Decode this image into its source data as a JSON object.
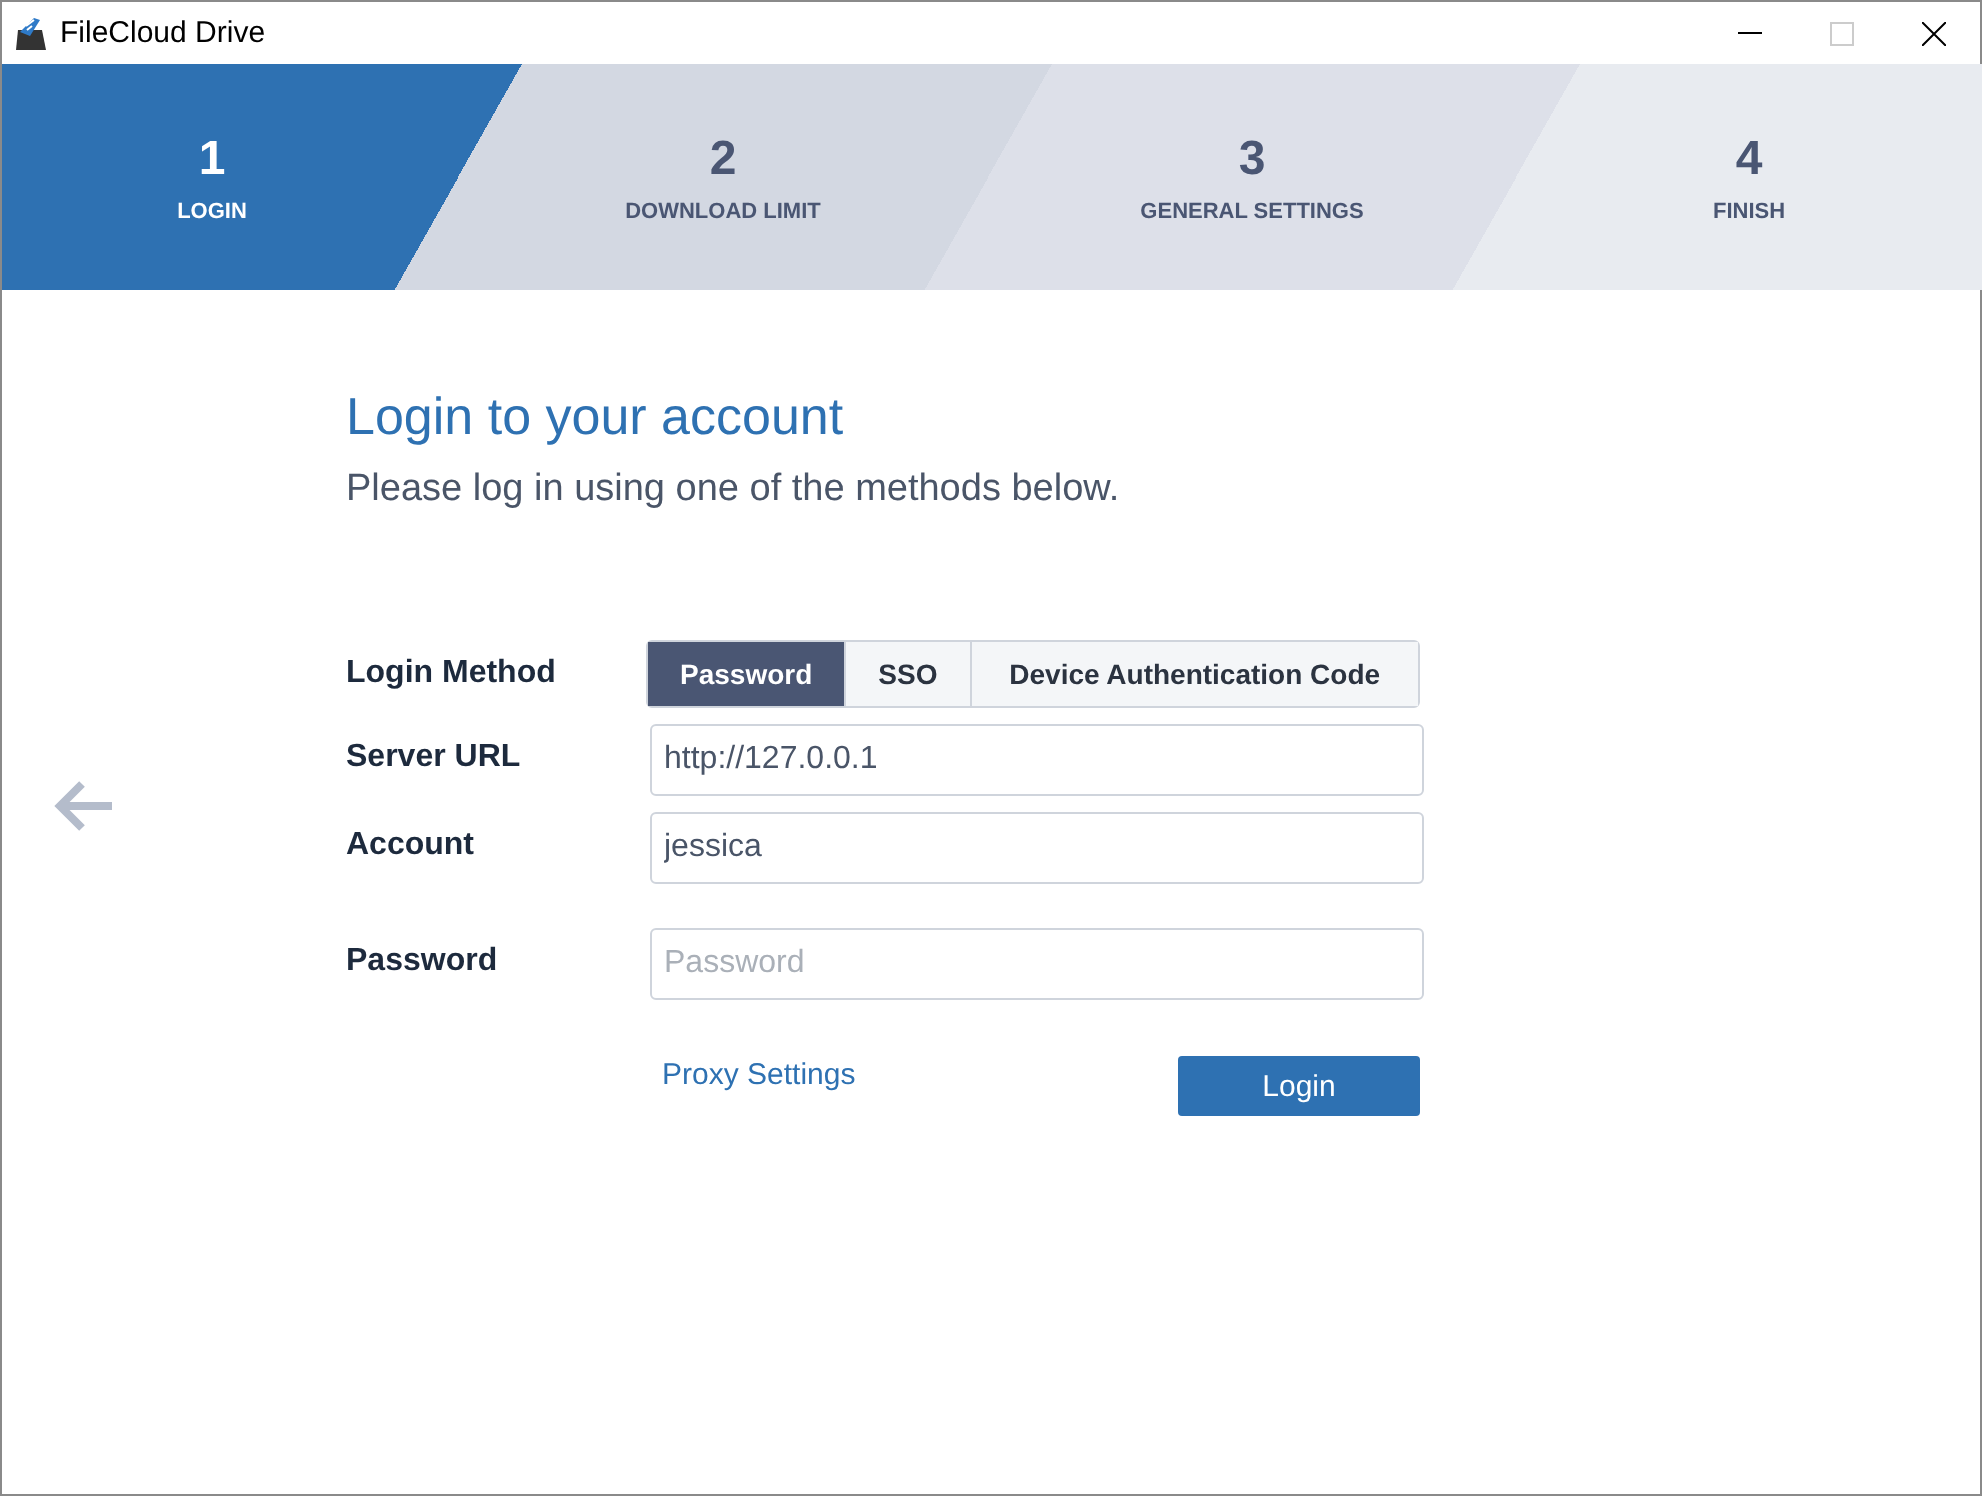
{
  "window": {
    "title": "FileCloud Drive"
  },
  "steps": [
    {
      "number": "1",
      "label": "LOGIN",
      "selected": true
    },
    {
      "number": "2",
      "label": "DOWNLOAD LIMIT",
      "selected": false
    },
    {
      "number": "3",
      "label": "GENERAL SETTINGS",
      "selected": false
    },
    {
      "number": "4",
      "label": "FINISH",
      "selected": false
    }
  ],
  "heading": "Login to your account",
  "subheading": "Please log in using one of the methods below.",
  "form": {
    "login_method": {
      "label": "Login Method",
      "options": [
        {
          "label": "Password",
          "selected": true
        },
        {
          "label": "SSO",
          "selected": false
        },
        {
          "label": "Device Authentication Code",
          "selected": false
        }
      ]
    },
    "fields": [
      {
        "label": "Server URL",
        "value": "http://127.0.0.1"
      },
      {
        "label": "Account",
        "value": "jessica"
      },
      {
        "label": "Password",
        "placeholder": "Password"
      }
    ],
    "proxy_link": "Proxy Settings",
    "submit": "Login"
  }
}
